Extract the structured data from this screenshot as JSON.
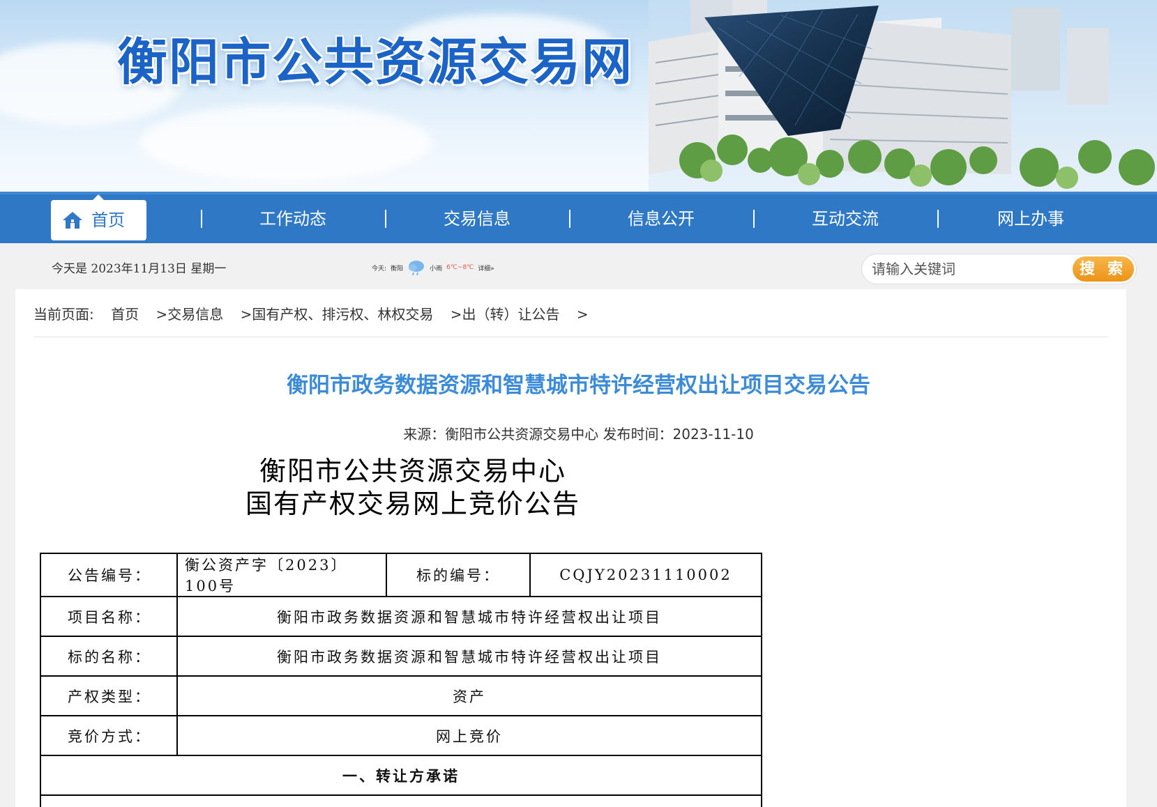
{
  "site": {
    "title": "衡阳市公共资源交易网"
  },
  "nav": {
    "home_label": "首页",
    "items": [
      "工作动态",
      "交易信息",
      "信息公开",
      "互动交流",
      "网上办事"
    ],
    "separator": "|"
  },
  "infobar": {
    "date": "今天是 2023年11月13日  星期一",
    "weather": {
      "prefix": "今天:",
      "city": "衡阳",
      "condition": "小雨",
      "temp": "6℃~8℃",
      "detail": "详细»"
    },
    "search": {
      "placeholder": "请输入关键词",
      "button": "搜 索"
    }
  },
  "breadcrumb": {
    "prefix": "当前页面:",
    "items": [
      "首页",
      "交易信息",
      "国有产权、排污权、林权交易",
      "出（转）让公告"
    ],
    "separator": ">"
  },
  "article": {
    "title": "衡阳市政务数据资源和智慧城市特许经营权出让项目交易公告",
    "meta": "来源：衡阳市公共资源交易中心 发布时间：2023-11-10"
  },
  "document": {
    "heading_line1": "衡阳市公共资源交易中心",
    "heading_line2": "国有产权交易网上竞价公告",
    "table": {
      "notice_no_label": "公告编号：",
      "notice_no_value": "衡公资产字〔2023〕100号",
      "target_no_label": "标的编号：",
      "target_no_value": "CQJY20231110002",
      "project_name_label": "项目名称：",
      "project_name_value": "衡阳市政务数据资源和智慧城市特许经营权出让项目",
      "target_name_label": "标的名称：",
      "target_name_value": "衡阳市政务数据资源和智慧城市特许经营权出让项目",
      "property_type_label": "产权类型：",
      "property_type_value": "资产",
      "bid_method_label": "竞价方式：",
      "bid_method_value": "网上竞价",
      "section1_title": "一、转让方承诺"
    }
  }
}
